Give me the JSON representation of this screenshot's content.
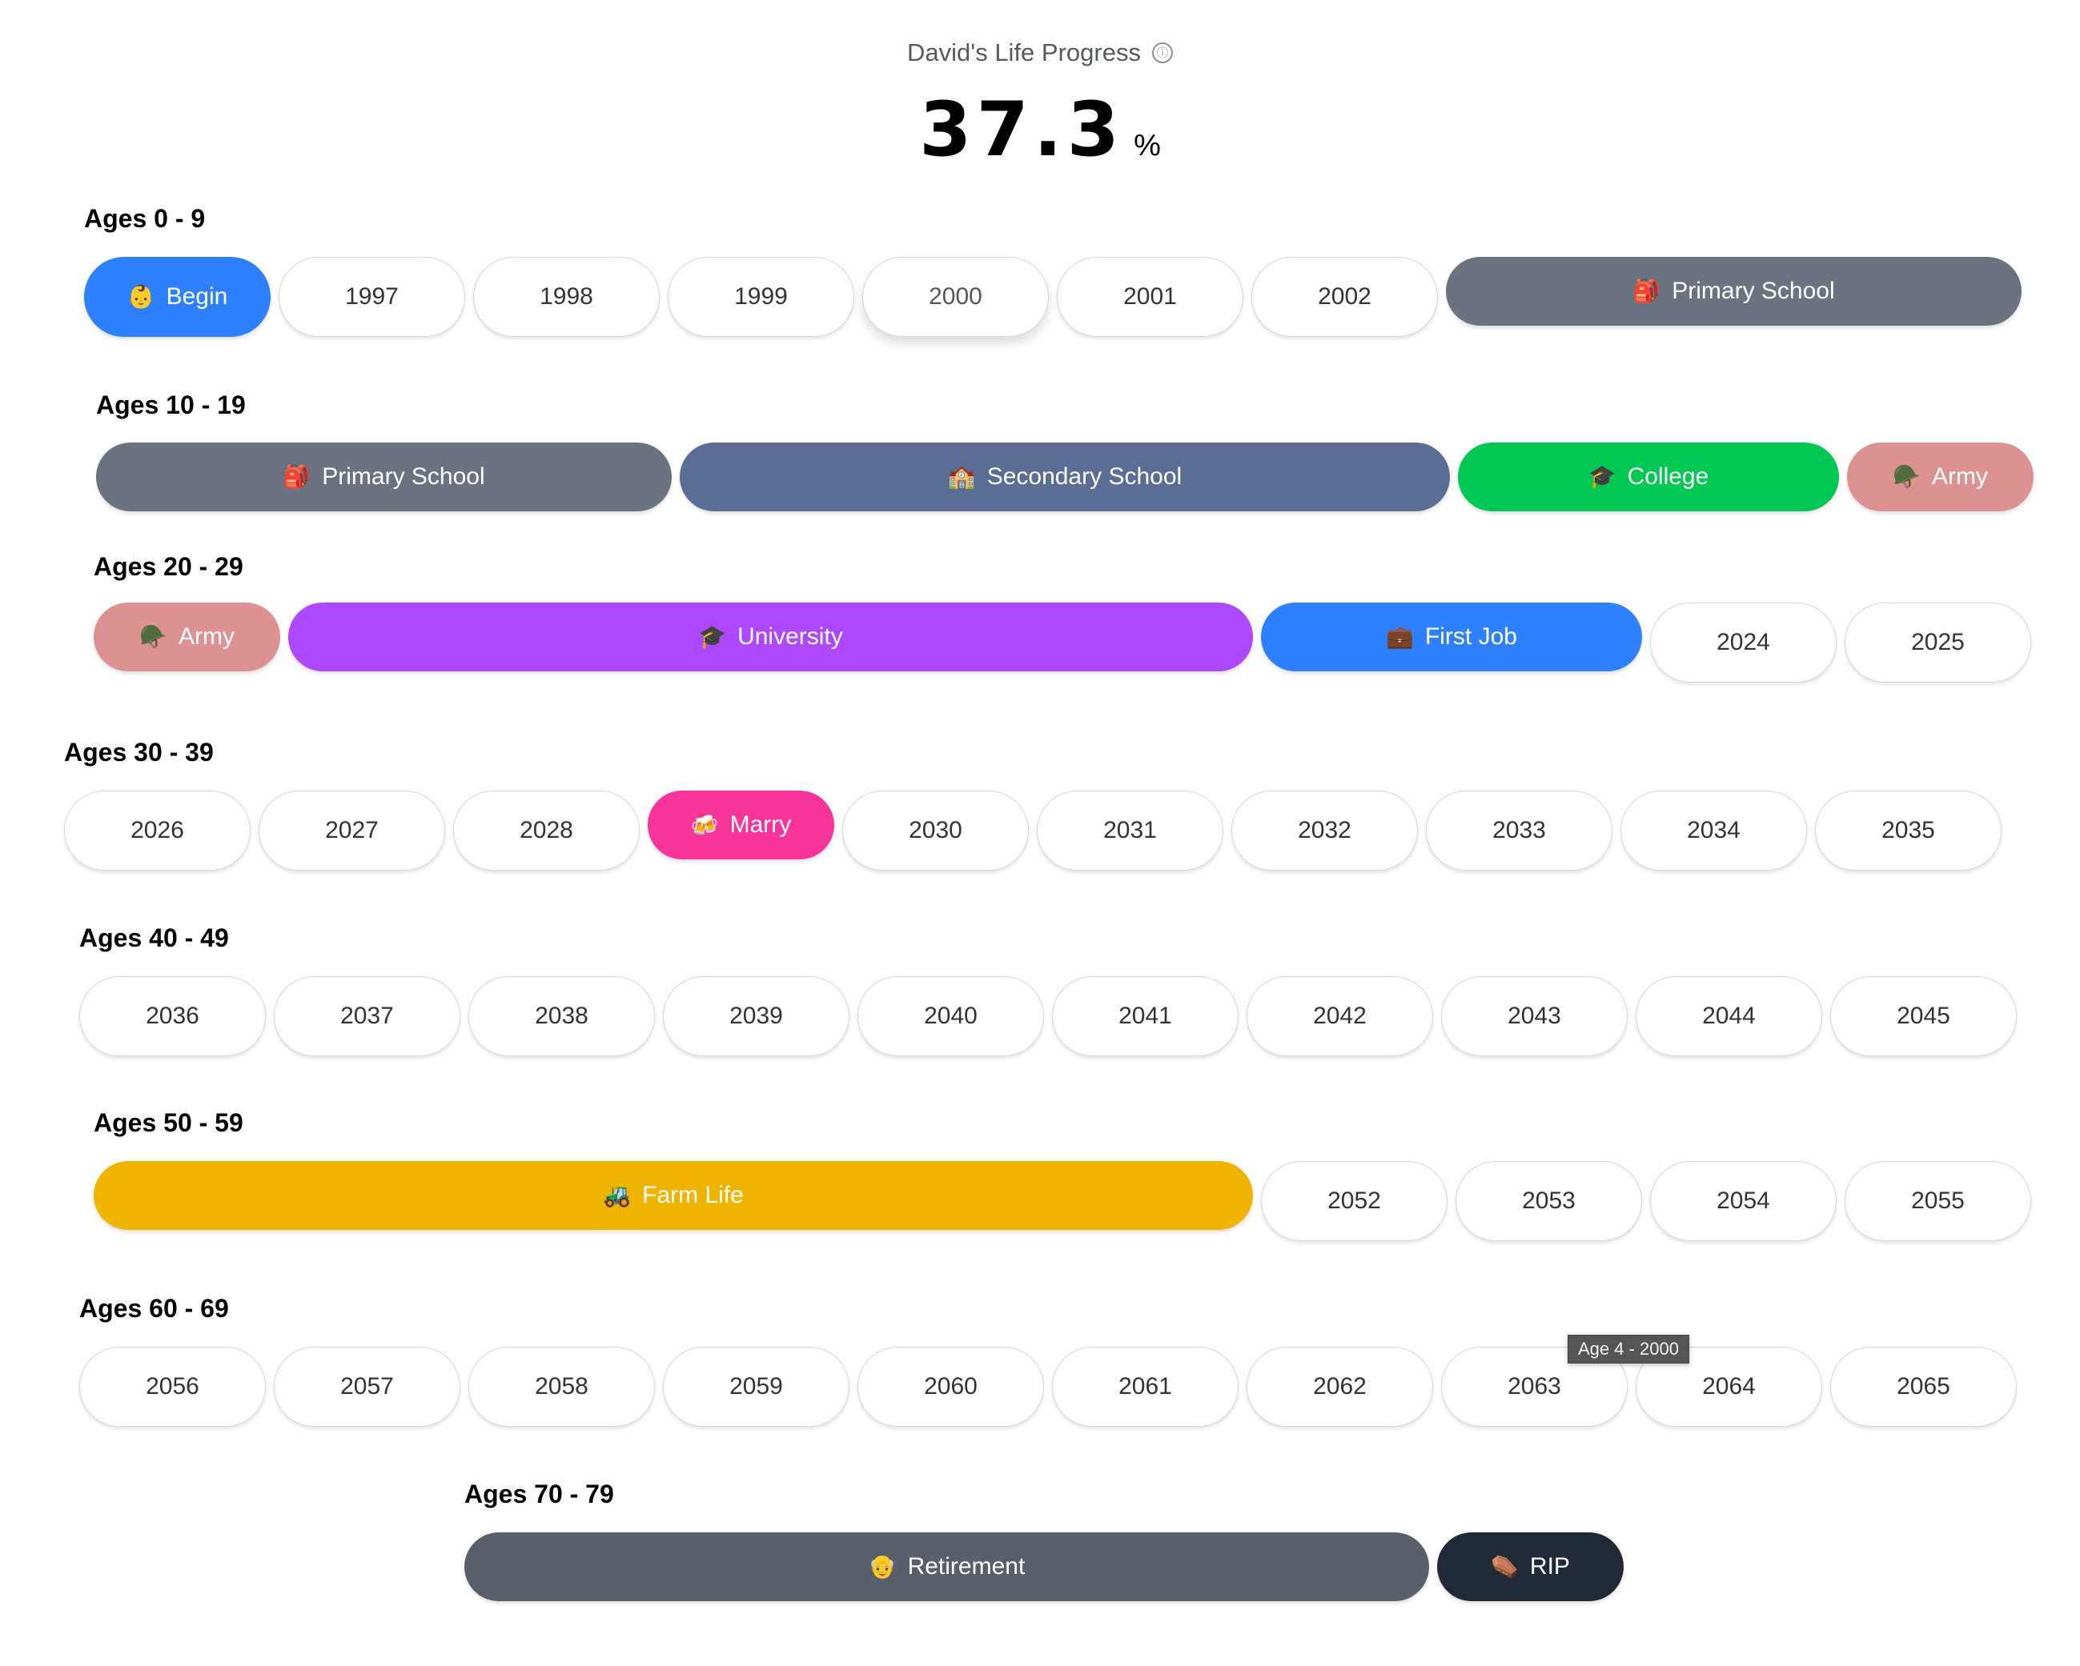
{
  "header": {
    "title": "David's Life Progress",
    "info_icon": "ⓘ",
    "progress_value": "37.3",
    "progress_unit": "%",
    "progress_percent": 37.3
  },
  "colors": {
    "begin": "#2f80ff",
    "primary_school": "#6b7280",
    "secondary_school": "#5a6d94",
    "college": "#00c853",
    "army": "#dd9292",
    "university": "#ad48ff",
    "first_job": "#2f80ff",
    "marry": "#f7349a",
    "farm_life": "#f0b400",
    "retirement": "#5a606b",
    "rip": "#1f2937"
  },
  "rows": [
    {
      "label": "Ages 0 - 9",
      "items": [
        {
          "type": "event",
          "label": "Begin",
          "emoji": "👶",
          "color_key": "begin",
          "span": 1
        },
        {
          "type": "year",
          "label": "1997"
        },
        {
          "type": "year",
          "label": "1998"
        },
        {
          "type": "year",
          "label": "1999"
        },
        {
          "type": "year",
          "label": "2000",
          "hovered": true
        },
        {
          "type": "year",
          "label": "2001"
        },
        {
          "type": "year",
          "label": "2002"
        },
        {
          "type": "event",
          "label": "Primary School",
          "emoji": "🎒",
          "color_key": "primary_school",
          "span": 3
        }
      ]
    },
    {
      "label": "Ages 10 - 19",
      "items": [
        {
          "type": "event",
          "label": "Primary School",
          "emoji": "🎒",
          "color_key": "primary_school",
          "span": 3
        },
        {
          "type": "event",
          "label": "Secondary School",
          "emoji": "🏫",
          "color_key": "secondary_school",
          "span": 4
        },
        {
          "type": "event",
          "label": "College",
          "emoji": "🎓",
          "color_key": "college",
          "span": 2
        },
        {
          "type": "event",
          "label": "Army",
          "emoji": "🪖",
          "color_key": "army",
          "span": 1
        }
      ]
    },
    {
      "label": "Ages 20 - 29",
      "items": [
        {
          "type": "event",
          "label": "Army",
          "emoji": "🪖",
          "color_key": "army",
          "span": 1
        },
        {
          "type": "event",
          "label": "University",
          "emoji": "🎓",
          "color_key": "university",
          "span": 5
        },
        {
          "type": "event",
          "label": "First Job",
          "emoji": "💼",
          "color_key": "first_job",
          "span": 2
        },
        {
          "type": "year",
          "label": "2024"
        },
        {
          "type": "year",
          "label": "2025"
        }
      ]
    },
    {
      "label": "Ages 30 - 39",
      "items": [
        {
          "type": "year",
          "label": "2026"
        },
        {
          "type": "year",
          "label": "2027"
        },
        {
          "type": "year",
          "label": "2028"
        },
        {
          "type": "event",
          "label": "Marry",
          "emoji": "🍻",
          "color_key": "marry",
          "span": 1
        },
        {
          "type": "year",
          "label": "2030"
        },
        {
          "type": "year",
          "label": "2031"
        },
        {
          "type": "year",
          "label": "2032"
        },
        {
          "type": "year",
          "label": "2033"
        },
        {
          "type": "year",
          "label": "2034"
        },
        {
          "type": "year",
          "label": "2035"
        }
      ]
    },
    {
      "label": "Ages 40 - 49",
      "items": [
        {
          "type": "year",
          "label": "2036"
        },
        {
          "type": "year",
          "label": "2037"
        },
        {
          "type": "year",
          "label": "2038"
        },
        {
          "type": "year",
          "label": "2039"
        },
        {
          "type": "year",
          "label": "2040"
        },
        {
          "type": "year",
          "label": "2041"
        },
        {
          "type": "year",
          "label": "2042"
        },
        {
          "type": "year",
          "label": "2043"
        },
        {
          "type": "year",
          "label": "2044"
        },
        {
          "type": "year",
          "label": "2045"
        }
      ]
    },
    {
      "label": "Ages 50 - 59",
      "items": [
        {
          "type": "event",
          "label": "Farm Life",
          "emoji": "🚜",
          "color_key": "farm_life",
          "span": 6
        },
        {
          "type": "year",
          "label": "2052"
        },
        {
          "type": "year",
          "label": "2053"
        },
        {
          "type": "year",
          "label": "2054"
        },
        {
          "type": "year",
          "label": "2055"
        }
      ]
    },
    {
      "label": "Ages 60 - 69",
      "items": [
        {
          "type": "year",
          "label": "2056"
        },
        {
          "type": "year",
          "label": "2057"
        },
        {
          "type": "year",
          "label": "2058"
        },
        {
          "type": "year",
          "label": "2059"
        },
        {
          "type": "year",
          "label": "2060"
        },
        {
          "type": "year",
          "label": "2061"
        },
        {
          "type": "year",
          "label": "2062"
        },
        {
          "type": "year",
          "label": "2063"
        },
        {
          "type": "year",
          "label": "2064"
        },
        {
          "type": "year",
          "label": "2065"
        }
      ]
    },
    {
      "label": "Ages 70 - 79",
      "items": [
        {
          "type": "event",
          "label": "Retirement",
          "emoji": "👴",
          "color_key": "retirement",
          "span": 5
        },
        {
          "type": "event",
          "label": "RIP",
          "emoji": "⚰️",
          "color_key": "rip",
          "span": 1
        }
      ]
    }
  ],
  "tooltip": {
    "text": "Age 4 - 2000"
  }
}
